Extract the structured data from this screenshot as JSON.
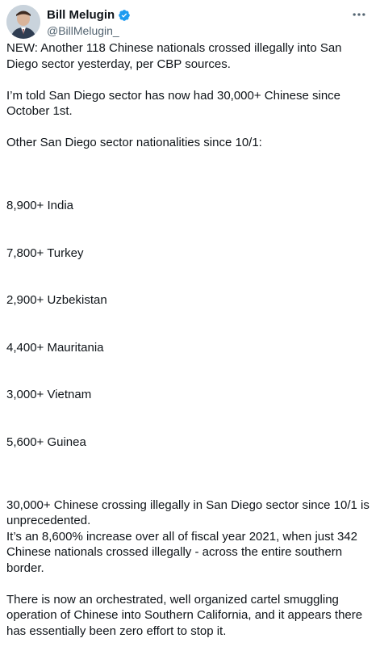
{
  "author": {
    "display_name": "Bill Melugin",
    "handle": "@BillMelugin_",
    "verified": true,
    "verified_color": "#1d9bf0"
  },
  "menu": {
    "icon": "more-horizontal-icon"
  },
  "tweet": {
    "p1": "NEW: Another 118 Chinese nationals crossed illegally into San Diego sector yesterday, per CBP sources.",
    "p2": "I’m told San Diego sector has now had 30,000+ Chinese since October 1st.",
    "p3": "Other San Diego sector nationalities since 10/1:",
    "nationalities": [
      "8,900+ India",
      "7,800+ Turkey",
      "2,900+ Uzbekistan",
      "4,400+ Mauritania",
      "3,000+ Vietnam",
      "5,600+ Guinea"
    ],
    "p4": "30,000+ Chinese crossing illegally in San Diego sector since 10/1 is unprecedented.\nIt’s an 8,600% increase over all of fiscal year 2021, when just 342 Chinese nationals crossed illegally - across the entire southern border.",
    "p5": "There is now an orchestrated, well organized cartel smuggling operation of Chinese into Southern California, and it appears there has essentially been zero effort to stop it."
  },
  "colors": {
    "text": "#0f1419",
    "secondary": "#536471"
  }
}
